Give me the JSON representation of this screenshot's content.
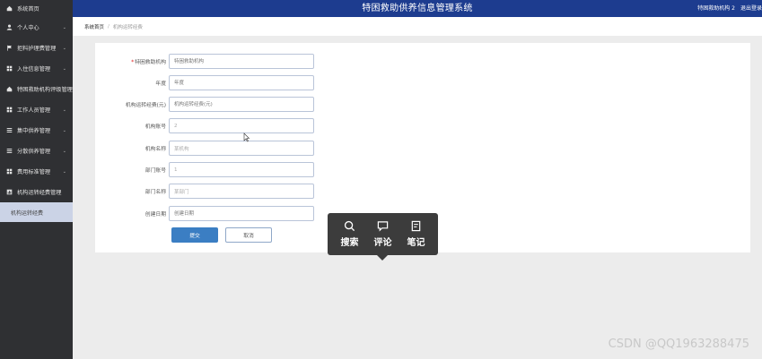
{
  "header": {
    "title": "特困救助供养信息管理系统",
    "user": "特困救助机构 2",
    "logout": "退出登录"
  },
  "sidebar": {
    "home": "系统首页",
    "items": [
      {
        "label": "个人中心",
        "icon": "user-icon",
        "chevron": true
      },
      {
        "label": "拒料护理费管理",
        "icon": "flag-icon",
        "chevron": true
      },
      {
        "label": "入住信息管理",
        "icon": "grid-icon",
        "chevron": true
      },
      {
        "label": "特困救助机构评级管理",
        "icon": "home-icon",
        "chevron": false
      },
      {
        "label": "工作人员管理",
        "icon": "grid-icon",
        "chevron": true
      },
      {
        "label": "集中供养管理",
        "icon": "list-icon",
        "chevron": true
      },
      {
        "label": "分散供养管理",
        "icon": "list-icon",
        "chevron": true
      },
      {
        "label": "费用标准管理",
        "icon": "grid-icon",
        "chevron": true
      },
      {
        "label": "机构运转经费管理",
        "icon": "chart-icon",
        "chevron": false
      }
    ],
    "active_sub": "机构运转经费"
  },
  "breadcrumb": {
    "home": "系统首页",
    "current": "机构运转经费"
  },
  "form": {
    "fields": [
      {
        "label": "特困救助机构",
        "required": true,
        "placeholder": "特困救助机构",
        "value": ""
      },
      {
        "label": "年度",
        "required": false,
        "placeholder": "年度",
        "value": ""
      },
      {
        "label": "机构运转经费(元)",
        "required": false,
        "placeholder": "机构运转经费(元)",
        "value": ""
      },
      {
        "label": "机构账号",
        "required": false,
        "placeholder": "",
        "value": "2"
      },
      {
        "label": "机构名称",
        "required": false,
        "placeholder": "",
        "value": "某机构"
      },
      {
        "label": "部门账号",
        "required": false,
        "placeholder": "",
        "value": "1"
      },
      {
        "label": "部门名称",
        "required": false,
        "placeholder": "",
        "value": "某部门"
      },
      {
        "label": "创建日期",
        "required": false,
        "placeholder": "创建日期",
        "value": ""
      }
    ],
    "submit_label": "提交",
    "cancel_label": "取消"
  },
  "float_toolbar": {
    "search": "搜索",
    "comment": "评论",
    "note": "笔记"
  },
  "watermark": "CSDN @QQ1963288475"
}
